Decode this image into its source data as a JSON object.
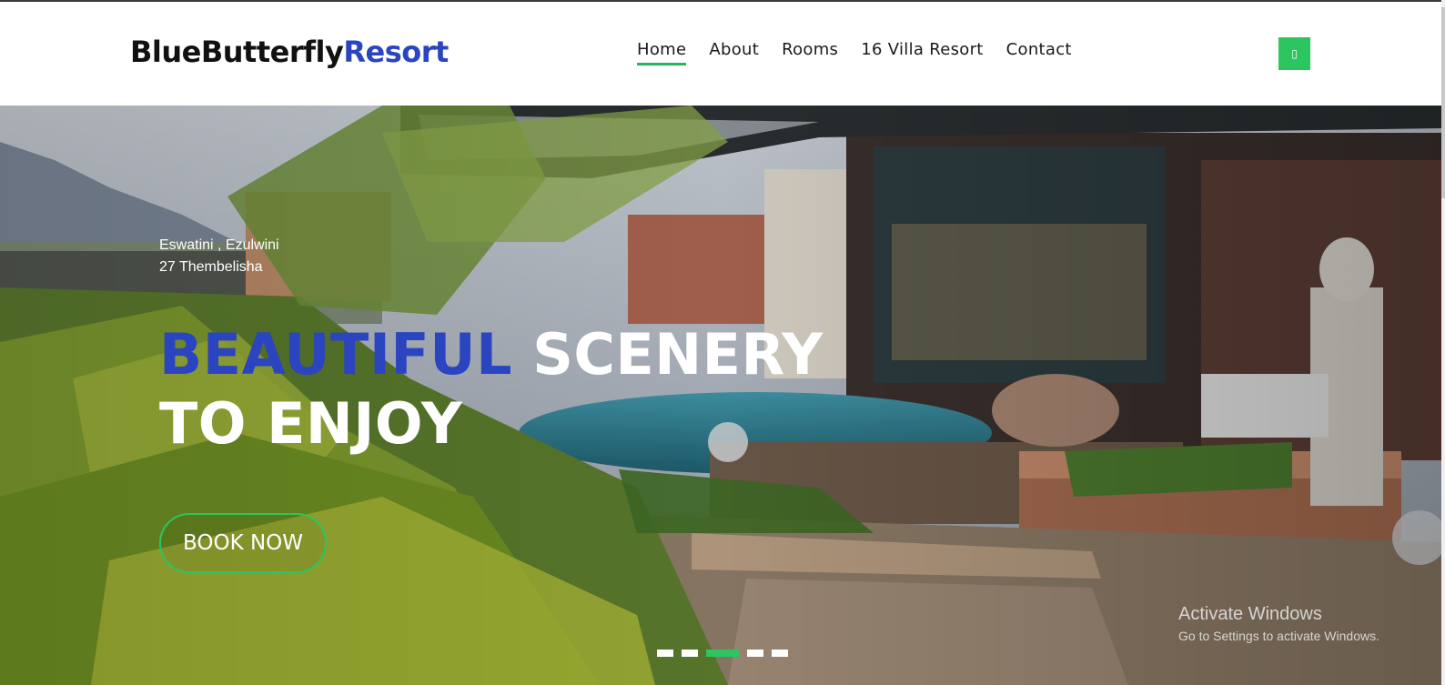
{
  "header": {
    "logo_primary": "BlueButterfly",
    "logo_accent": "Resort",
    "nav": [
      {
        "label": "Home",
        "active": true
      },
      {
        "label": "About",
        "active": false
      },
      {
        "label": "Rooms",
        "active": false
      },
      {
        "label": "16 Villa Resort",
        "active": false
      },
      {
        "label": "Contact",
        "active": false
      }
    ],
    "menu_icon": "menu-icon"
  },
  "hero": {
    "location_line1": "Eswatini , Ezulwini",
    "location_line2": "27 Thembelisha",
    "headline_blue": "BEAUTIFUL",
    "headline_white_1": "SCENERY",
    "headline_white_2": "TO ENJOY",
    "cta_label": "BOOK NOW",
    "slides_total": 5,
    "active_slide": 3
  },
  "watermark": {
    "title": "Activate Windows",
    "subtitle": "Go to Settings to activate Windows."
  },
  "colors": {
    "brand_blue": "#2b44c0",
    "accent_green": "#2cc55f"
  }
}
